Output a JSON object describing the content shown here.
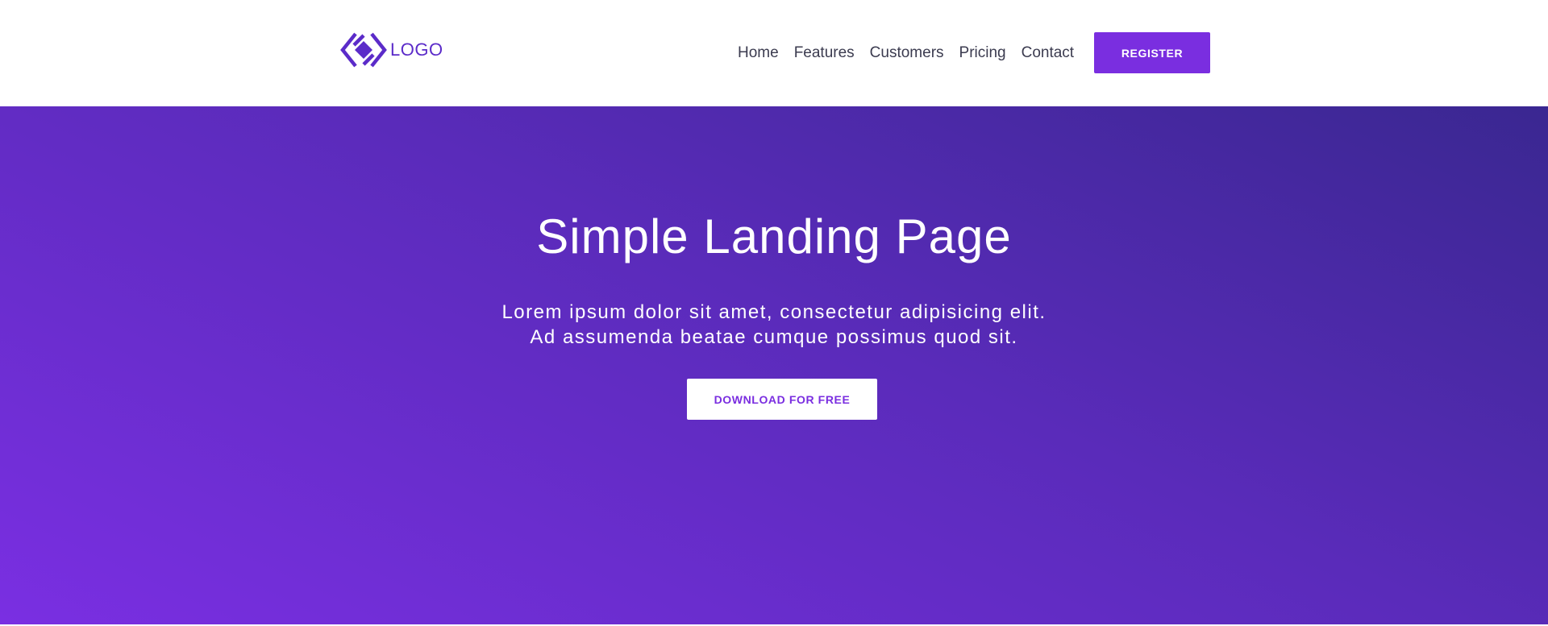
{
  "brand": {
    "logo_text": "LOGO",
    "logo_icon": "diamond-logo-icon",
    "accent_color": "#7a2ee0",
    "logo_color": "#5b2bc9"
  },
  "nav": {
    "items": [
      {
        "label": "Home"
      },
      {
        "label": "Features"
      },
      {
        "label": "Customers"
      },
      {
        "label": "Pricing"
      },
      {
        "label": "Contact"
      }
    ],
    "register_label": "REGISTER"
  },
  "hero": {
    "title": "Simple Landing Page",
    "subtitle_line1": "Lorem ipsum dolor sit amet, consectetur adipisicing elit.",
    "subtitle_line2": "Ad assumenda beatae cumque possimus quod sit.",
    "cta_label": "DOWNLOAD FOR FREE",
    "gradient_colors": [
      "#3a2791",
      "#5a2bba",
      "#7a2fe2"
    ]
  }
}
